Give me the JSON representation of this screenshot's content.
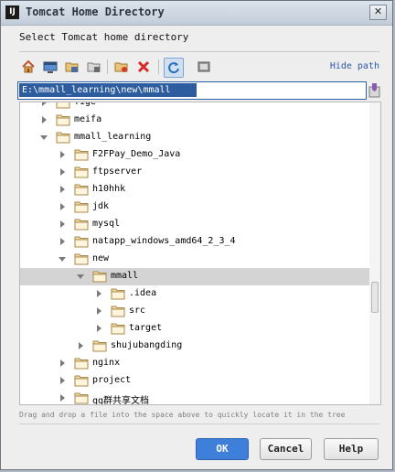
{
  "window": {
    "app_icon_label": "IJ",
    "title": "Tomcat Home Directory",
    "close_glyph": "✕"
  },
  "dialog": {
    "subtitle": "Select Tomcat home directory",
    "hide_path_label": "Hide path",
    "path_value": "E:\\mmall_learning\\new\\mmall",
    "hint": "Drag and drop a file into the space above to quickly locate it in the tree"
  },
  "toolbar": {
    "buttons": [
      {
        "name": "home-icon",
        "active": false
      },
      {
        "name": "desktop-icon",
        "active": false
      },
      {
        "name": "project-folder-icon",
        "active": false
      },
      {
        "name": "module-folder-icon",
        "active": false
      },
      {
        "name": "new-folder-icon",
        "active": false
      },
      {
        "name": "delete-icon",
        "active": false
      },
      {
        "name": "refresh-icon",
        "active": true
      },
      {
        "name": "show-hidden-icon",
        "active": false
      }
    ]
  },
  "tree": {
    "rows": [
      {
        "label": "fige",
        "level": 0,
        "arrow": "right",
        "selected": false
      },
      {
        "label": "meifa",
        "level": 0,
        "arrow": "right",
        "selected": false
      },
      {
        "label": "mmall_learning",
        "level": 0,
        "arrow": "down",
        "selected": false
      },
      {
        "label": "F2FPay_Demo_Java",
        "level": 1,
        "arrow": "right",
        "selected": false
      },
      {
        "label": "ftpserver",
        "level": 1,
        "arrow": "right",
        "selected": false
      },
      {
        "label": "h10hhk",
        "level": 1,
        "arrow": "right",
        "selected": false
      },
      {
        "label": "jdk",
        "level": 1,
        "arrow": "right",
        "selected": false
      },
      {
        "label": "mysql",
        "level": 1,
        "arrow": "right",
        "selected": false
      },
      {
        "label": "natapp_windows_amd64_2_3_4",
        "level": 1,
        "arrow": "right",
        "selected": false
      },
      {
        "label": "new",
        "level": 1,
        "arrow": "down",
        "selected": false
      },
      {
        "label": "mmall",
        "level": 2,
        "arrow": "down",
        "selected": true
      },
      {
        "label": ".idea",
        "level": 3,
        "arrow": "right",
        "selected": false
      },
      {
        "label": "src",
        "level": 3,
        "arrow": "right",
        "selected": false
      },
      {
        "label": "target",
        "level": 3,
        "arrow": "right",
        "selected": false
      },
      {
        "label": "shujubangding",
        "level": 2,
        "arrow": "right",
        "selected": false
      },
      {
        "label": "nginx",
        "level": 1,
        "arrow": "right",
        "selected": false
      },
      {
        "label": "project",
        "level": 1,
        "arrow": "right",
        "selected": false
      },
      {
        "label": "qq群共享文档",
        "level": 1,
        "arrow": "right",
        "selected": false
      }
    ]
  },
  "buttons": {
    "ok": "OK",
    "cancel": "Cancel",
    "help": "Help"
  },
  "colors": {
    "selection_bg": "#2d5d9f",
    "folder_fill": "#e8c37a",
    "ok_button": "#3d7fd9"
  }
}
